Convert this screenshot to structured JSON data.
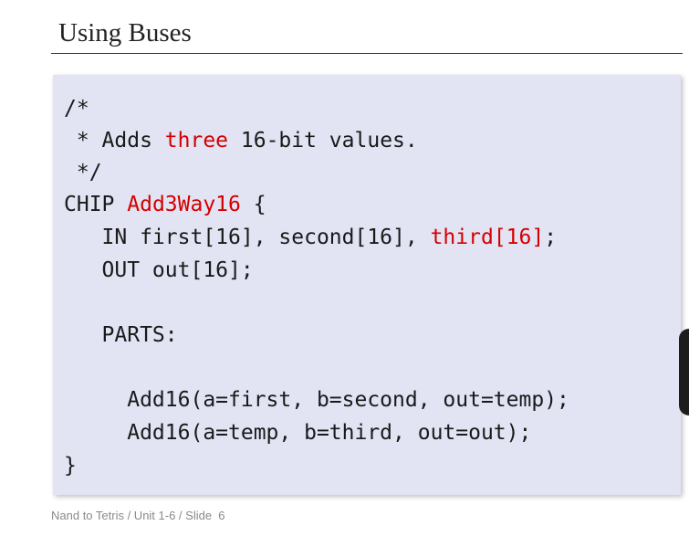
{
  "slide": {
    "title": "Using Buses",
    "footer": "Nand to Tetris / Unit 1-6 / Slide  6"
  },
  "code": {
    "comment_open": "/*",
    "comment_prefix": " * Adds ",
    "comment_highlight": "three",
    "comment_suffix": " 16-bit values.",
    "comment_close": " */",
    "chip_keyword": "CHIP ",
    "chip_name": "Add3Way16",
    "chip_brace": " {",
    "in_prefix": "   IN first[16], second[16], ",
    "in_highlight": "third[16]",
    "in_suffix": ";",
    "out_line": "   OUT out[16];",
    "parts_line": "   PARTS:",
    "part1_line": "     Add16(a=first, b=second, out=temp);",
    "part2_line": "     Add16(a=temp, b=third, out=out);",
    "close_brace": "}"
  },
  "colors": {
    "highlight": "#d40000",
    "code_background": "#e2e3f3"
  }
}
